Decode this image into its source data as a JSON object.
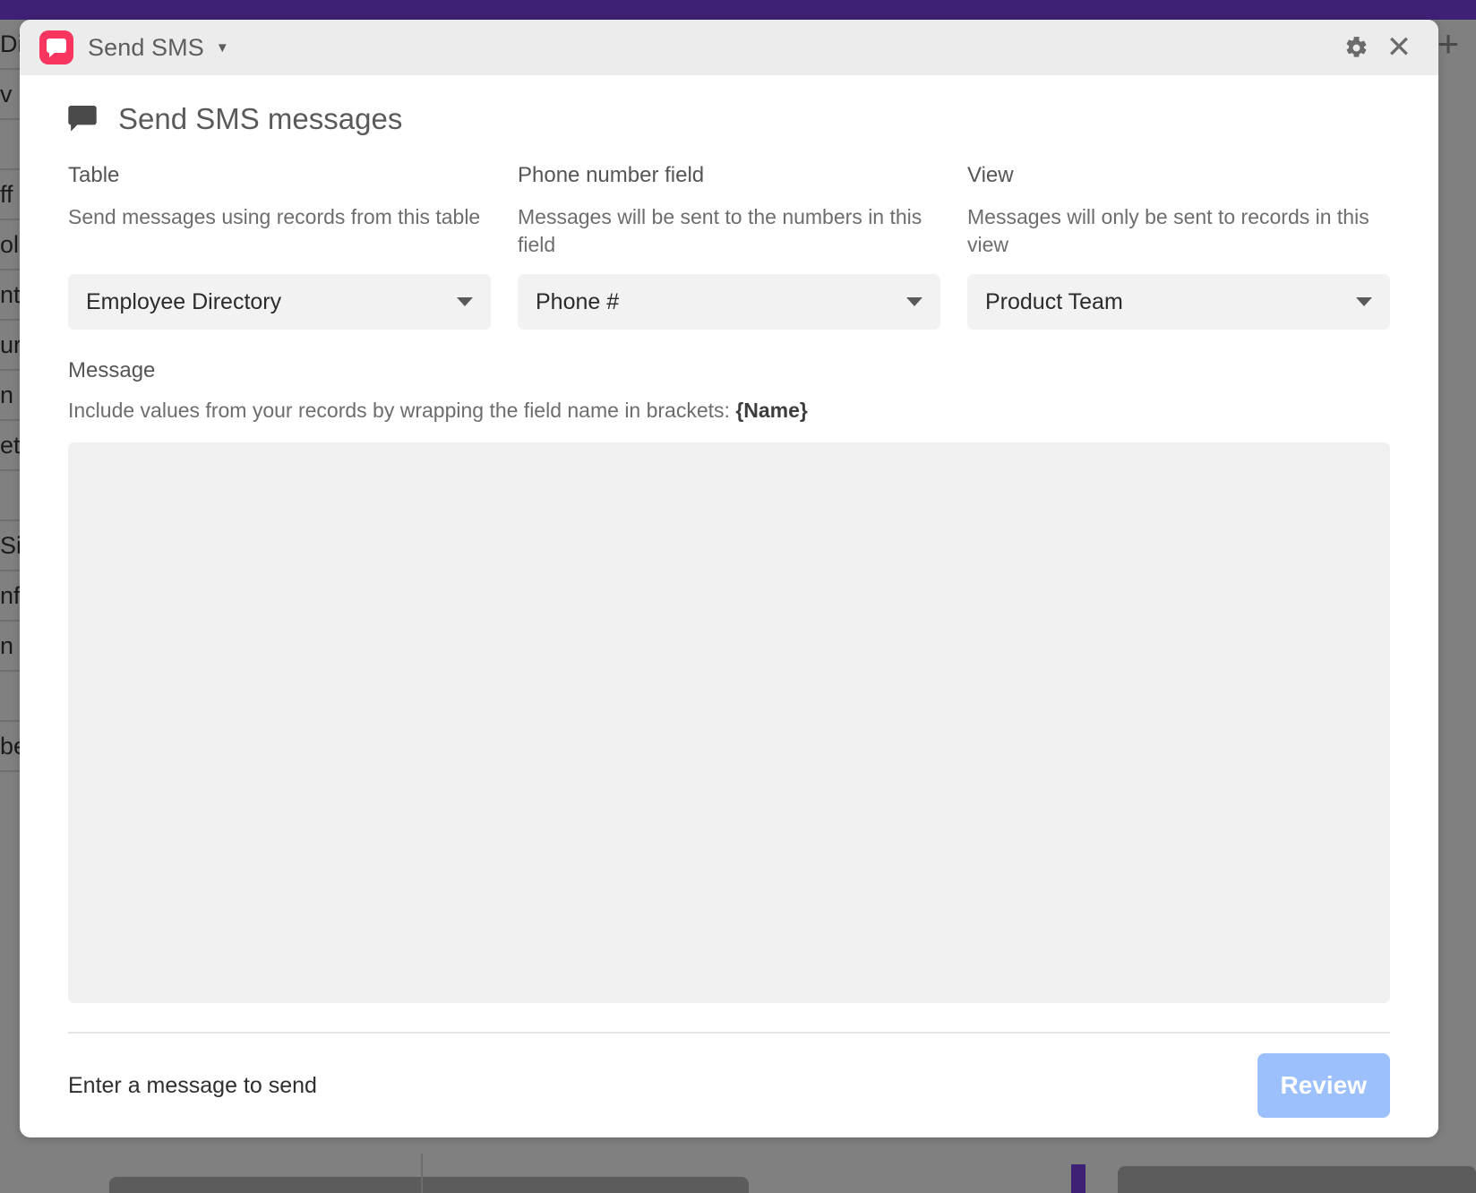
{
  "background": {
    "top_bar_color": "#3e2174",
    "page_bg_color": "#808080",
    "table_rows": [
      "Di",
      "v",
      "",
      "ff",
      "ol",
      "ntz",
      "ur",
      "n",
      "et",
      "",
      "Sin",
      "nfe",
      "n",
      "",
      "be"
    ],
    "plus_icon": "plus-icon"
  },
  "panel": {
    "header": {
      "app_icon": "sms-bubble-app-icon",
      "app_icon_color": "#f8355e",
      "app_title": "Send SMS",
      "caret": "▼",
      "settings_icon": "gear-icon",
      "close_icon": "close-icon"
    },
    "content": {
      "title": "Send SMS messages",
      "title_icon": "speech-bubble-icon",
      "config_columns": [
        {
          "label": "Table",
          "description": "Send messages using records from this table",
          "selected": "Employee Directory",
          "name": "table-select"
        },
        {
          "label": "Phone number field",
          "description": "Messages will be sent to the numbers in this field",
          "selected": "Phone #",
          "name": "phone-field-select"
        },
        {
          "label": "View",
          "description": "Messages will only be sent to records in this view",
          "selected": "Product Team",
          "name": "view-select"
        }
      ],
      "message": {
        "label": "Message",
        "hint_prefix": "Include values from your records by wrapping the field name in brackets: ",
        "hint_token": "{Name}",
        "value": "",
        "placeholder": ""
      }
    },
    "footer": {
      "status": "Enter a message to send",
      "review_label": "Review",
      "review_color": "#9cc0fb"
    }
  }
}
